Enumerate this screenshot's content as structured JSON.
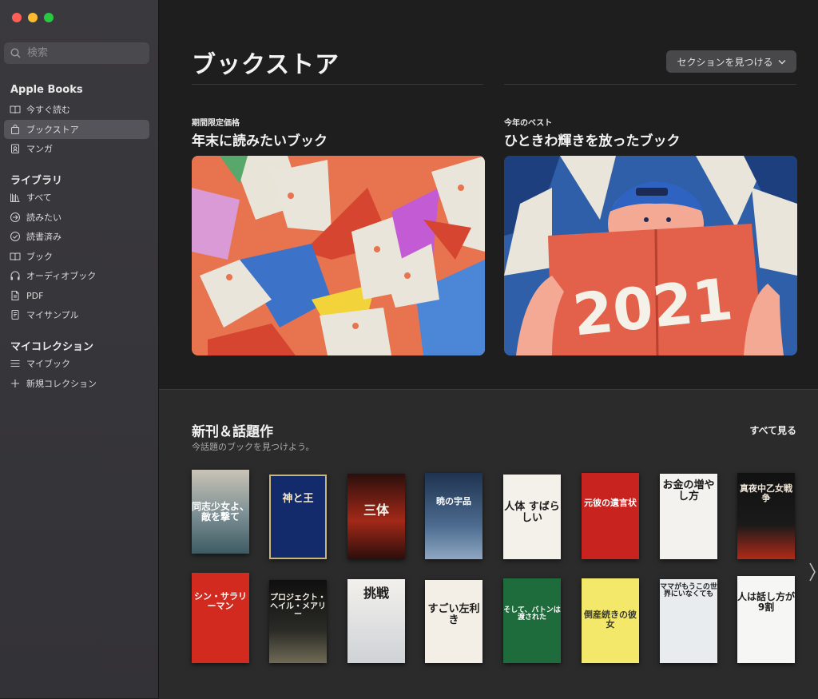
{
  "sidebar": {
    "search_placeholder": "検索",
    "sections": [
      {
        "title": "Apple Books",
        "items": [
          {
            "label": "今すぐ読む",
            "icon": "book-open-icon"
          },
          {
            "label": "ブックストア",
            "icon": "shopping-bag-icon",
            "selected": true
          },
          {
            "label": "マンガ",
            "icon": "manga-icon"
          }
        ]
      },
      {
        "title": "ライブラリ",
        "items": [
          {
            "label": "すべて",
            "icon": "library-icon"
          },
          {
            "label": "読みたい",
            "icon": "arrow-circle-icon"
          },
          {
            "label": "読書済み",
            "icon": "check-circle-icon"
          },
          {
            "label": "ブック",
            "icon": "book-open-icon"
          },
          {
            "label": "オーディオブック",
            "icon": "headphones-icon"
          },
          {
            "label": "PDF",
            "icon": "document-icon"
          },
          {
            "label": "マイサンプル",
            "icon": "sample-icon"
          }
        ]
      },
      {
        "title": "マイコレクション",
        "items": [
          {
            "label": "マイブック",
            "icon": "list-icon"
          },
          {
            "label": "新規コレクション",
            "icon": "plus-icon"
          }
        ]
      }
    ]
  },
  "main": {
    "title": "ブックストア",
    "section_button": "セクションを見つける",
    "features": [
      {
        "eyebrow": "期間限定価格",
        "title": "年末に読みたいブック",
        "banner": "paper-shapes"
      },
      {
        "eyebrow": "今年のベスト",
        "title": "ひときわ輝きを放ったブック",
        "banner": "2021"
      }
    ],
    "banner2_text": "2021",
    "new_releases": {
      "title": "新刊＆話題作",
      "subtitle": "今話題のブックを見つけよう。",
      "see_all": "すべて見る",
      "row1": [
        {
          "title": "同志少女よ、敵を撃て"
        },
        {
          "title": "神と王"
        },
        {
          "title": "三体"
        },
        {
          "title": "暁の宇品"
        },
        {
          "title": "人体 すばらしい"
        },
        {
          "title": "元彼の遺言状"
        },
        {
          "title": "お金の増やし方"
        },
        {
          "title": "真夜中乙女戦争"
        }
      ],
      "row2": [
        {
          "title": "シン・サラリーマン"
        },
        {
          "title": "プロジェクト・ヘイル・メアリー"
        },
        {
          "title": "挑戦"
        },
        {
          "title": "すごい左利き"
        },
        {
          "title": "そして、バトンは渡された"
        },
        {
          "title": "倒産続きの彼女"
        },
        {
          "title": "ママがもうこの世界にいなくても"
        },
        {
          "title": "人は話し方が9割"
        }
      ]
    }
  },
  "colors": {
    "sidebar_selected": "#55545a",
    "banner1_bg": "#e7744e",
    "banner2_bg": "#2f5fa8"
  }
}
